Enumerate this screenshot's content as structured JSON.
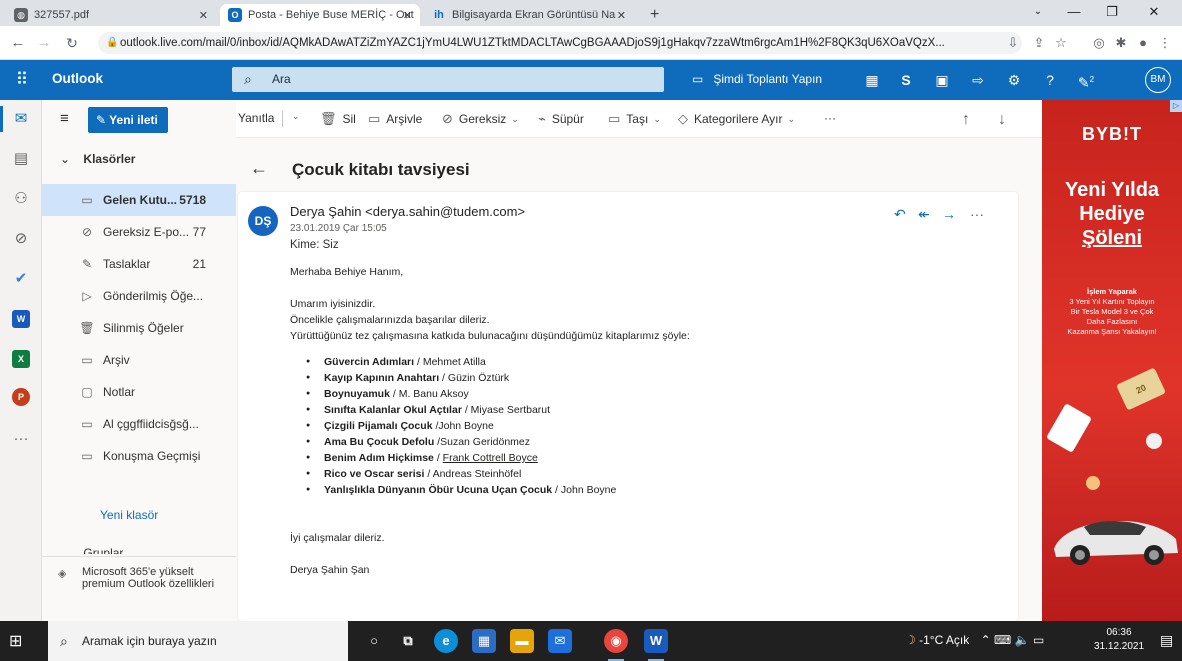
{
  "browser": {
    "tabs": [
      {
        "title": "327557.pdf",
        "active": false
      },
      {
        "title": "Posta - Behiye Buse MERİÇ - Out",
        "active": true
      },
      {
        "title": "Bilgisayarda Ekran Görüntüsü Na",
        "active": false
      }
    ],
    "new_tab": "+",
    "url": "outlook.live.com/mail/0/inbox/id/AQMkADAwATZiZmYAZC1jYmU4LWU1ZTktMDACLTAwCgBGAAADjoS9j1gHakqv7zzaWtm6rgcAm1H%2F8QK3qU6XOaVQzX..."
  },
  "outlook": {
    "app_name": "Outlook",
    "search_placeholder": "Ara",
    "meet_now": "Şimdi Toplantı Yapın",
    "avatar": "BM",
    "notif_count": "2"
  },
  "folder_pane": {
    "new_message": "Yeni ileti",
    "folders_heading": "Klasörler",
    "folders": [
      {
        "name": "Gelen Kutu...",
        "count": "5718",
        "icon": "inbox-icon",
        "selected": true
      },
      {
        "name": "Gereksiz E-po...",
        "count": "77",
        "icon": "junk-icon",
        "selected": false
      },
      {
        "name": "Taslaklar",
        "count": "21",
        "icon": "draft-icon",
        "selected": false
      },
      {
        "name": "Gönderilmiş Öğe...",
        "count": "",
        "icon": "sent-icon",
        "selected": false
      },
      {
        "name": "Silinmiş Öğeler",
        "count": "",
        "icon": "trash-icon",
        "selected": false
      },
      {
        "name": "Arşiv",
        "count": "",
        "icon": "archive-icon",
        "selected": false
      },
      {
        "name": "Notlar",
        "count": "",
        "icon": "notes-icon",
        "selected": false
      },
      {
        "name": "Al çggffiidcisğsğ...",
        "count": "",
        "icon": "folder-icon",
        "selected": false
      },
      {
        "name": "Konuşma Geçmişi",
        "count": "",
        "icon": "folder-icon",
        "selected": false
      }
    ],
    "new_folder": "Yeni klasör",
    "groups_heading": "Gruplar",
    "promo": "Microsoft 365'e yükselt premium Outlook özellikleri"
  },
  "command_bar": {
    "reply": "Yanıtla",
    "delete": "Sil",
    "archive": "Arşivle",
    "junk": "Gereksiz",
    "sweep": "Süpür",
    "move": "Taşı",
    "categorize": "Kategorilere Ayır",
    "more": "···"
  },
  "message": {
    "subject": "Çocuk kitabı tavsiyesi",
    "sender_initials": "DŞ",
    "sender": "Derya Şahin <derya.sahin@tudem.com>",
    "date": "23.01.2019 Çar 15:05",
    "to": "Kime:  Siz",
    "greeting": "Merhaba Behiye Hanım,",
    "line1": "Umarım iyisinizdir.",
    "line2": "Öncelikle çalışmalarınızda başarılar dileriz.",
    "line3": "Yürüttüğünüz tez çalışmasına katkıda bulunacağını düşündüğümüz kitaplarımız şöyle:",
    "books": [
      {
        "title": "Güvercin Adımları",
        "sep": " / ",
        "author": "Mehmet Atilla",
        "link": false
      },
      {
        "title": "Kayıp Kapının Anahtarı",
        "sep": " / ",
        "author": "Güzin Öztürk",
        "link": false
      },
      {
        "title": "Boynuyamuk",
        "sep": " / ",
        "author": "M. Banu Aksoy",
        "link": false
      },
      {
        "title": "Sınıfta Kalanlar Okul Açtılar",
        "sep": " / ",
        "author": "Miyase Sertbarut",
        "link": false
      },
      {
        "title": "Çizgili Pijamalı Çocuk",
        "sep": " /",
        "author": "John Boyne",
        "link": false
      },
      {
        "title": "Ama Bu Çocuk Defolu",
        "sep": " /",
        "author": "Suzan Geridönmez",
        "link": false
      },
      {
        "title": "Benim Adım Hiçkimse",
        "sep": " / ",
        "author": "Frank Cottrell Boyce",
        "link": true
      },
      {
        "title": "Rico ve Oscar serisi",
        "sep": " / ",
        "author": "Andreas Steinhöfel",
        "link": false
      },
      {
        "title": "Yanlışlıkla Dünyanın Öbür Ucuna Uçan Çocuk",
        "sep": " / ",
        "author": "John Boyne",
        "link": false
      }
    ],
    "closing": "İyi çalışmalar dileriz.",
    "signature": "Derya Şahin Şan"
  },
  "ad": {
    "brand": "BYB!T",
    "headline1": "Yeni Yılda",
    "headline2": "Hediye",
    "headline3": "Şöleni",
    "sub1": "İşlem Yaparak",
    "sub2": "3 Yeni Yıl Kartını Toplayın",
    "sub3": "Bir Tesla Model 3 ve Çok",
    "sub4": "Daha Fazlasını",
    "sub5": "Kazanma Şansı Yakalayın!",
    "card_number": "20"
  },
  "taskbar": {
    "search_placeholder": "Aramak için buraya yazın",
    "weather": "-1°C  Açık",
    "time": "06:36",
    "date": "31.12.2021"
  },
  "colors": {
    "outlook_blue": "#0f6cbd",
    "selected_folder": "#cfe4fa",
    "ad_red": "#d32a22"
  }
}
